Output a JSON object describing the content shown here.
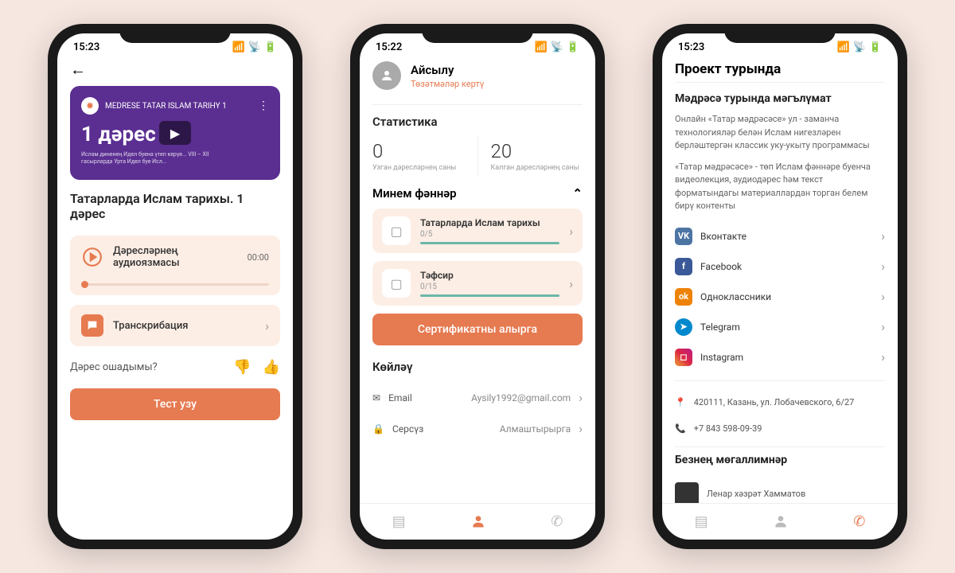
{
  "status_time_1": "15:23",
  "status_time_2": "15:22",
  "status_time_3": "15:23",
  "screen1": {
    "video_channel": "MEDRESE TATAR ISLAM TARIHY 1",
    "video_title": "1 дәрес",
    "video_sub": "Ислам диненең Идел буена үтеп керүе...\nVIII – XII гасырларда Урта Идел буе Исл...",
    "lesson_title": "Татарларда Ислам тарихы. 1 дәрес",
    "audio_label": "Дәресләрнең аудиоязмасы",
    "audio_time": "00:00",
    "transcript_label": "Транскрибация",
    "feedback_q": "Дәрес ошадымы?",
    "test_btn": "Тест узу"
  },
  "screen2": {
    "name": "Айсылу",
    "edit": "Төзәтмәләр кертү",
    "stats_title": "Статистика",
    "stat1_num": "0",
    "stat1_label": "Узган дәресләрнең саны",
    "stat2_num": "20",
    "stat2_label": "Калган дәресләрнең саны",
    "subjects_title": "Минем фәннәр",
    "course1_name": "Татарларда Ислам тарихы",
    "course1_prog": "0/5",
    "course2_name": "Тәфсир",
    "course2_prog": "0/15",
    "cert_btn": "Сертификатны алырга",
    "settings_title": "Көйләү",
    "email_label": "Email",
    "email_val": "Aysily1992@gmail.com",
    "pass_label": "Серсүз",
    "pass_val": "Алмаштырырга"
  },
  "screen3": {
    "title": "Проект турында",
    "info_heading": "Мәдрәсә турында мәгълүмат",
    "info_p1": "Онлайн «Татар мәдрәсәсе» ул - заманча технологияләр белән Ислам нигезләрен берләштергән классик уку-укыту программасы",
    "info_p2": "«Татар мәдрәсәсе» - төп Ислам фәннәре буенча видеолекция, аудиодәрес һәм текст форматындагы материаллардан торган белем бирү контенты",
    "social_vk": "Вконтакте",
    "social_fb": "Facebook",
    "social_ok": "Одноклассники",
    "social_tg": "Telegram",
    "social_ig": "Instagram",
    "address": "420111, Казань, ул. Лобачевского, 6/27",
    "phone": "+7 843 598-09-39",
    "teachers_title": "Безнең мөгаллимнәр",
    "teacher1": "Ленар хәзрәт Хамматов"
  }
}
